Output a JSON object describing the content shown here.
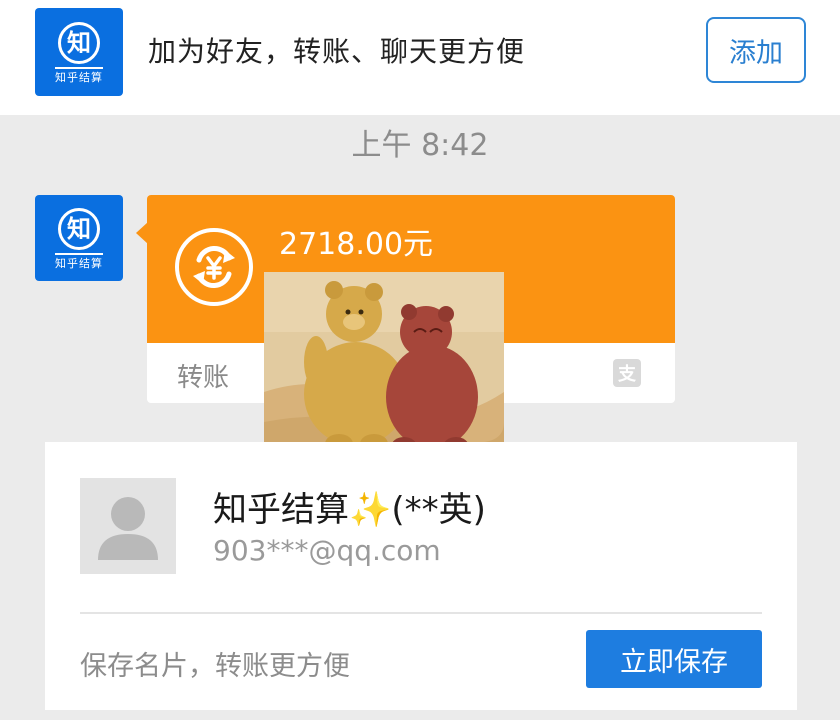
{
  "top_bar": {
    "logo_char": "知",
    "logo_sub": "知乎结算",
    "prompt_text": "加为好友，转账、聊天更方便",
    "add_button_label": "添加"
  },
  "timestamp": "上午 8:42",
  "message": {
    "sender_logo_char": "知",
    "sender_logo_sub": "知乎结算",
    "transfer": {
      "amount_text": "2718.00元",
      "type_label": "转账",
      "accent_color": "#fb9312",
      "icon": "yuan-refresh-icon"
    }
  },
  "contact_card": {
    "name": "知乎结算✨(**英)",
    "email": "903***@qq.com",
    "save_hint": "保存名片，转账更方便",
    "save_button_label": "立即保存"
  },
  "colors": {
    "brand_blue": "#0a6fe0",
    "button_blue": "#1e7de0",
    "transfer_orange": "#fb9312"
  }
}
